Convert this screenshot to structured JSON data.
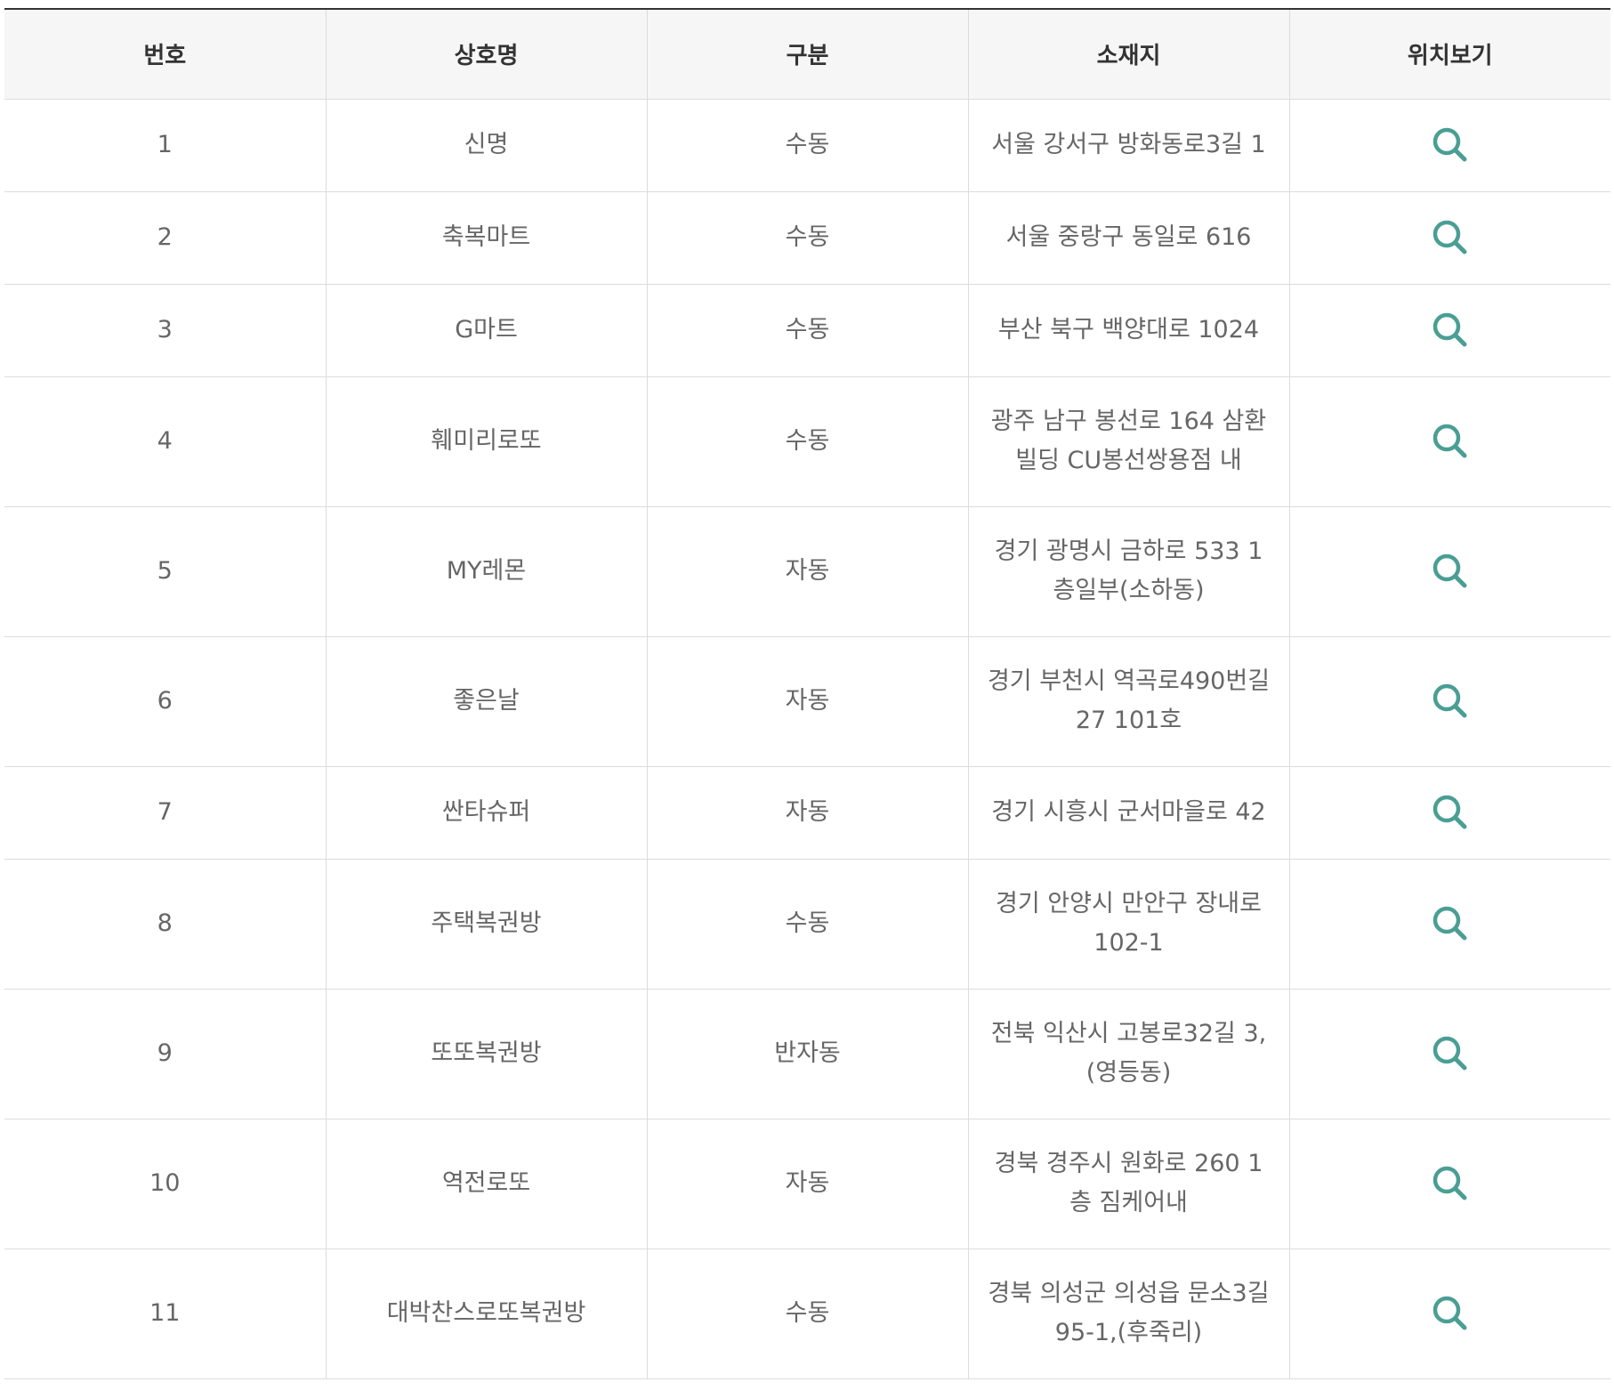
{
  "table": {
    "headers": [
      "번호",
      "상호명",
      "구분",
      "소재지",
      "위치보기"
    ],
    "rows": [
      {
        "no": "1",
        "name": "신명",
        "type": "수동",
        "address": "서울 강서구 방화동로3길 1"
      },
      {
        "no": "2",
        "name": "축복마트",
        "type": "수동",
        "address": "서울 중랑구 동일로 616"
      },
      {
        "no": "3",
        "name": "G마트",
        "type": "수동",
        "address": "부산 북구 백양대로 1024"
      },
      {
        "no": "4",
        "name": "훼미리로또",
        "type": "수동",
        "address": "광주 남구 봉선로 164 삼환빌딩 CU봉선쌍용점 내"
      },
      {
        "no": "5",
        "name": "MY레몬",
        "type": "자동",
        "address": "경기 광명시 금하로 533 1층일부(소하동)"
      },
      {
        "no": "6",
        "name": "좋은날",
        "type": "자동",
        "address": "경기 부천시 역곡로490번길 27 101호"
      },
      {
        "no": "7",
        "name": "싼타슈퍼",
        "type": "자동",
        "address": "경기 시흥시 군서마을로 42"
      },
      {
        "no": "8",
        "name": "주택복권방",
        "type": "수동",
        "address": "경기 안양시 만안구 장내로 102-1"
      },
      {
        "no": "9",
        "name": "또또복권방",
        "type": "반자동",
        "address": "전북 익산시 고봉로32길 3,(영등동)"
      },
      {
        "no": "10",
        "name": "역전로또",
        "type": "자동",
        "address": "경북 경주시 원화로 260 1층 짐케어내"
      },
      {
        "no": "11",
        "name": "대박찬스로또복권방",
        "type": "수동",
        "address": "경북 의성군 의성읍 문소3길 95-1,(후죽리)"
      }
    ]
  },
  "icons": {
    "view_location": "search-icon",
    "accent_color": "#4a9e94"
  }
}
